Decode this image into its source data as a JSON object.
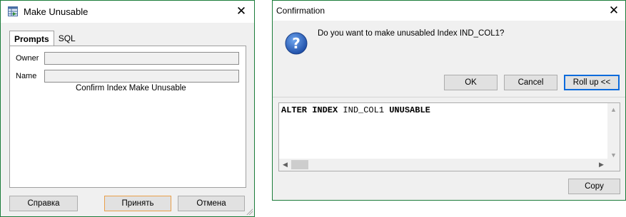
{
  "make_unusable": {
    "title": "Make Unusable",
    "tabs": [
      {
        "label": "Prompts",
        "active": true
      },
      {
        "label": "SQL",
        "active": false
      }
    ],
    "owner_label": "Owner",
    "owner_value": "",
    "name_label": "Name",
    "name_value": "",
    "confirm_text": "Confirm Index Make Unusable",
    "buttons": {
      "help": "Справка",
      "apply": "Принять",
      "cancel": "Отмена"
    }
  },
  "confirmation": {
    "title": "Confirmation",
    "message": "Do you want to make unusabled Index IND_COL1?",
    "buttons": {
      "ok": "OK",
      "cancel": "Cancel",
      "rollup": "Roll up <<",
      "copy": "Copy"
    },
    "sql": {
      "kw1": "ALTER INDEX",
      "ident": "IND_COL1",
      "kw2": "UNUSABLE"
    }
  },
  "colors": {
    "window_border": "#1b7c3a",
    "focus_border": "#e9a04b",
    "default_button_border": "#0d6bdc",
    "question_icon": "#1f5fbf"
  },
  "icons": [
    "app-table-icon",
    "close-icon",
    "question-icon",
    "scroll-up-icon",
    "scroll-down-icon",
    "scroll-left-icon",
    "scroll-right-icon"
  ]
}
